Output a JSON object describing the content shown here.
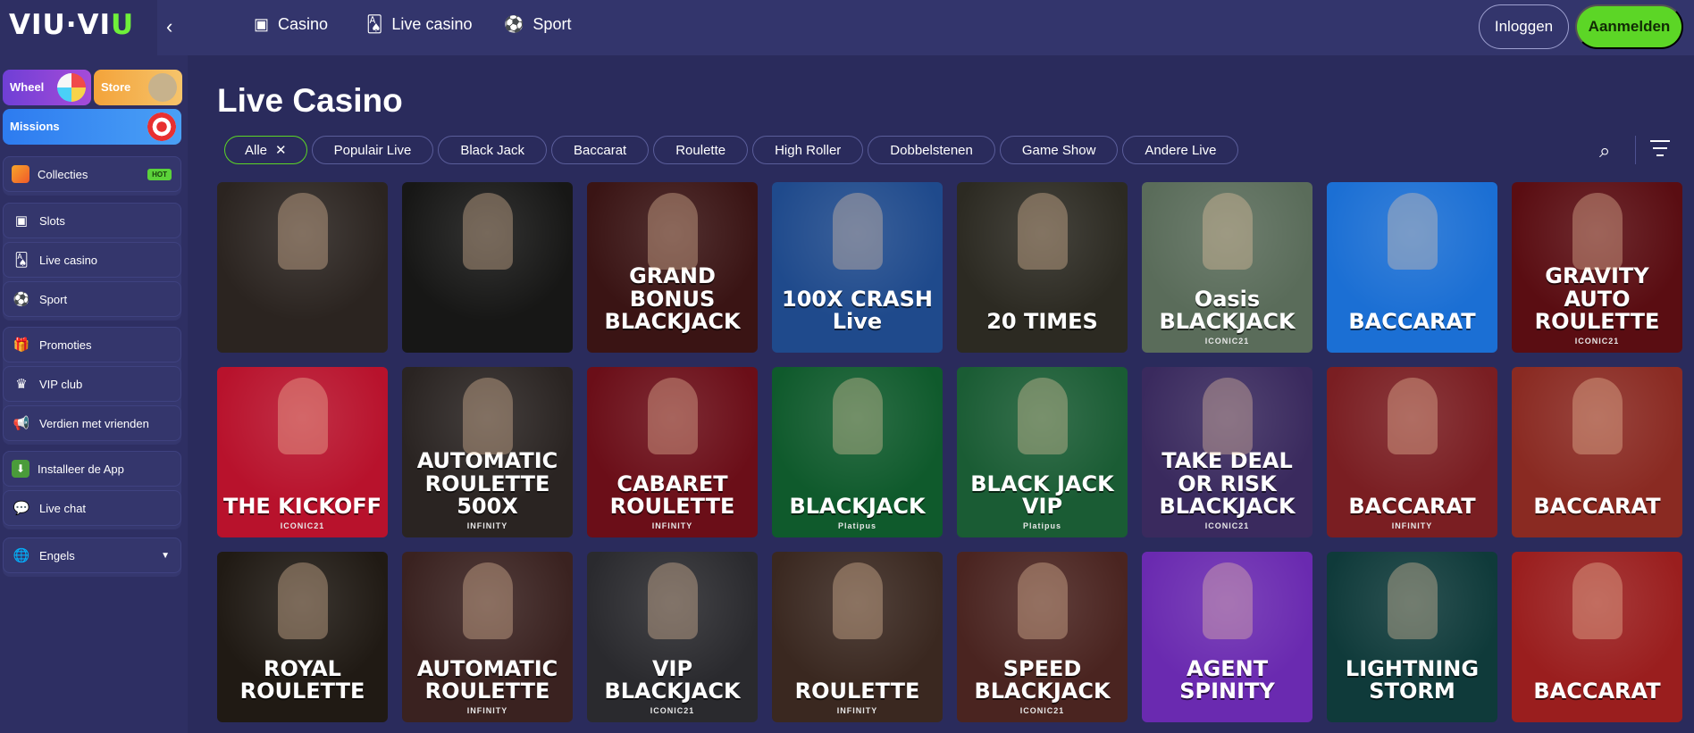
{
  "app": {
    "logo_left": "VIU",
    "logo_dot": "·",
    "logo_right_1": "VI",
    "logo_right_u": "U"
  },
  "sidebar": {
    "promo": {
      "wheel": "Wheel",
      "store": "Store",
      "missions": "Missions"
    },
    "items": [
      {
        "label": "Collecties",
        "icon": "collection-icon",
        "badge": "HOT"
      },
      {
        "label": "Slots",
        "icon": "slot-machine-icon"
      },
      {
        "label": "Live casino",
        "icon": "cards-icon"
      },
      {
        "label": "Sport",
        "icon": "soccer-ball-icon"
      },
      {
        "label": "Promoties",
        "icon": "gift-icon"
      },
      {
        "label": "VIP club",
        "icon": "medal-icon"
      },
      {
        "label": "Verdien met vrienden",
        "icon": "megaphone-icon"
      },
      {
        "label": "Installeer de App",
        "icon": "download-icon"
      },
      {
        "label": "Live chat",
        "icon": "chat-icon"
      }
    ],
    "language": "Engels"
  },
  "topbar": {
    "nav": [
      {
        "label": "Casino",
        "icon": "slot-icon"
      },
      {
        "label": "Live casino",
        "icon": "live-cards-icon"
      },
      {
        "label": "Sport",
        "icon": "soccer-ball-icon"
      }
    ],
    "login": "Inloggen",
    "register": "Aanmelden"
  },
  "main": {
    "title": "Live Casino",
    "filters": [
      "Alle",
      "Populair Live",
      "Black Jack",
      "Baccarat",
      "Roulette",
      "High Roller",
      "Dobbelstenen",
      "Game Show",
      "Andere Live"
    ],
    "active_filter": "Alle"
  },
  "games": [
    {
      "title": "",
      "brand": "",
      "bg": "#2b2420"
    },
    {
      "title": "",
      "brand": "",
      "bg": "#171716"
    },
    {
      "title": "GRAND BONUS BLACKJACK",
      "brand": "",
      "bg": "#3a1414"
    },
    {
      "title": "100X CRASH Live",
      "brand": "",
      "bg": "#1f4a8c"
    },
    {
      "title": "20 TIMES",
      "brand": "",
      "bg": "#2c2a22"
    },
    {
      "title": "Oasis BLACKJACK",
      "brand": "ICONIC21",
      "bg": "#5a6c5a"
    },
    {
      "title": "BACCARAT",
      "brand": "",
      "bg": "#1b6fd4"
    },
    {
      "title": "GRAVITY AUTO ROULETTE",
      "brand": "ICONIC21",
      "bg": "#5a0d12"
    },
    {
      "title": "THE KICKOFF",
      "brand": "ICONIC21",
      "bg": "#b8122c"
    },
    {
      "title": "AUTOMATIC ROULETTE 500X",
      "brand": "INFINITY",
      "bg": "#2a2422"
    },
    {
      "title": "CABARET ROULETTE",
      "brand": "INFINITY",
      "bg": "#6b0e18"
    },
    {
      "title": "BLACKJACK",
      "brand": "Platipus",
      "bg": "#0f5a2c"
    },
    {
      "title": "BLACK JACK VIP",
      "brand": "Platipus",
      "bg": "#1a5c34"
    },
    {
      "title": "TAKE DEAL OR RISK BLACKJACK",
      "brand": "ICONIC21",
      "bg": "#3a2a5e"
    },
    {
      "title": "BACCARAT",
      "brand": "INFINITY",
      "bg": "#7a1e22"
    },
    {
      "title": "BACCARAT",
      "brand": "",
      "bg": "#8a2a22"
    },
    {
      "title": "ROYAL ROULETTE",
      "brand": "",
      "bg": "#201a14"
    },
    {
      "title": "AUTOMATIC ROULETTE",
      "brand": "INFINITY",
      "bg": "#3a2220"
    },
    {
      "title": "VIP BLACKJACK",
      "brand": "ICONIC21",
      "bg": "#2a2a2e"
    },
    {
      "title": "ROULETTE",
      "brand": "INFINITY",
      "bg": "#3a2820"
    },
    {
      "title": "SPEED BLACKJACK",
      "brand": "ICONIC21",
      "bg": "#4a2420"
    },
    {
      "title": "AGENT SPINITY",
      "brand": "",
      "bg": "#6a2ab0"
    },
    {
      "title": "LIGHTNING STORM",
      "brand": "",
      "bg": "#0f3a3a"
    },
    {
      "title": "BACCARAT",
      "brand": "",
      "bg": "#9a1e1e"
    }
  ]
}
